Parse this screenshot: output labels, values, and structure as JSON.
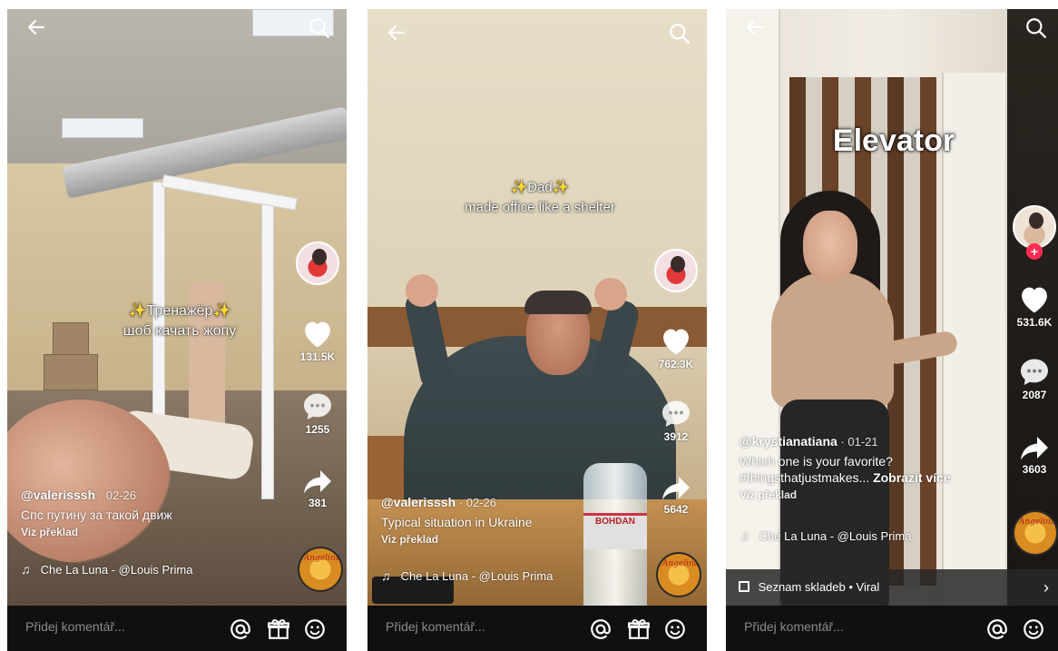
{
  "colors": {
    "accent": "#fe2c55",
    "bottom_bar": "#101010",
    "text": "#ffffff"
  },
  "icons": {
    "back": "arrow-left-icon",
    "search": "search-icon",
    "like": "heart-icon",
    "comment": "comment-icon",
    "share": "share-icon",
    "music": "music-note-icon",
    "mention": "at-icon",
    "gift": "gift-icon",
    "emoji": "emoji-icon",
    "playlist": "playlist-icon"
  },
  "screens": [
    {
      "caption_lines": [
        "✨Тренажёр✨",
        "шоб качать жопу"
      ],
      "likes": "131.5K",
      "comments": "1255",
      "shares": "381",
      "username": "@valerisssh",
      "date": " · 02-26",
      "description": "Спс путину за такой движ",
      "translate": "Viz překlad",
      "music": "Che La Luna - @Louis Prima",
      "comment_placeholder": "Přidej komentář...",
      "disc_title": "Angelina"
    },
    {
      "caption_lines": [
        "✨Dad✨",
        "made office like a shelter"
      ],
      "likes": "762.3K",
      "comments": "3912",
      "shares": "5642",
      "username": "@valerisssh",
      "date": " · 02-26",
      "description": "Typical situation in Ukraine",
      "translate": "Viz překlad",
      "music": "Che La Luna - @Louis Prima",
      "comment_placeholder": "Přidej komentář...",
      "disc_title": "Angelina",
      "bottle_text": "BOHDAN"
    },
    {
      "caption_big": "Elevator",
      "likes": "531.6K",
      "comments": "2087",
      "shares": "3603",
      "username": "@krystianatiana",
      "date": " · 01-21",
      "description_1": "Which one is your favorite?",
      "description_2": "#thingsthatjustmakes...",
      "more": "Zobrazit více",
      "translate": "Viz překlad",
      "music": "Che La Luna - @Louis Prima",
      "playlist": "Seznam skladeb • Viral",
      "comment_placeholder": "Přidej komentář...",
      "disc_title": "Angelina"
    }
  ]
}
